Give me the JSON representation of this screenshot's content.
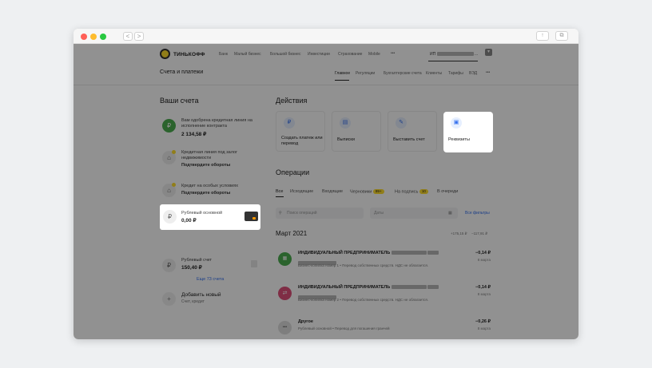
{
  "window": {
    "back": "<",
    "forward": ">",
    "share_icon": "↑",
    "tabs_icon": "⧉"
  },
  "header": {
    "brand": "ТИНЬКОФФ",
    "nav": [
      "Банк",
      "Малый бизнес",
      "Большой бизнес",
      "Инвестиции",
      "Страхование",
      "Mobile"
    ],
    "more": "•••",
    "account_prefix": "ИП",
    "account_suffix": "...",
    "account_chevron": "▾"
  },
  "subheader": {
    "title": "Счета и платежи",
    "tabs": [
      "Главное",
      "Регуляции",
      "Бухгалтерские счета",
      "Клиенты",
      "Тарифы",
      "ВЭД"
    ],
    "active_tab": 0,
    "more": "•••"
  },
  "accounts": {
    "title": "Ваши счета",
    "items": [
      {
        "title": "Вам одобрена кредитная линия на исполнение контракта",
        "value": "2 134,58 ₽",
        "icon": "₽"
      },
      {
        "title": "Кредитная линия под залог недвижимости",
        "sub": "Подтвердите обороты",
        "icon": "⌂"
      },
      {
        "title": "Кредит на особых условиях",
        "sub": "Подтвердите обороты",
        "icon": "⌂"
      },
      {
        "title": "Рублевый основной",
        "value": "0,00 ₽",
        "icon": "₽"
      },
      {
        "title": "Рублевый счет",
        "value": "150,40 ₽",
        "icon": "₽"
      }
    ],
    "more_link": "Еще 73 счета",
    "add_title": "Добавить новый",
    "add_sub": "Счет, кредит",
    "add_icon": "+"
  },
  "actions": {
    "title": "Действия",
    "items": [
      {
        "label": "Создать платеж или перевод",
        "icon": "₽"
      },
      {
        "label": "Выписки",
        "icon": "▤"
      },
      {
        "label": "Выставить счет",
        "icon": "✎"
      },
      {
        "label": "Реквизиты",
        "icon": "▣"
      }
    ]
  },
  "operations": {
    "title": "Операции",
    "tabs": [
      {
        "label": "Все"
      },
      {
        "label": "Исходящие"
      },
      {
        "label": "Входящие"
      },
      {
        "label": "Черновики",
        "badge": "99+"
      },
      {
        "label": "На подпись",
        "badge": "10"
      },
      {
        "label": "В очереди"
      }
    ],
    "search_placeholder": "Поиск операций",
    "date_placeholder": "Даты",
    "all_filters": "Все фильтры",
    "month": "Март 2021",
    "totals": [
      "+175,15 ₽",
      "−117,91 ₽"
    ],
    "items": [
      {
        "title": "ИНДИВИДУАЛЬНЫЙ ПРЕДПРИНИМАТЕЛЬ",
        "sub": "Бизнес-копилка номер 1  •  Перевод собственных средств. НДС не облагается.",
        "amount": "−0,14 ₽",
        "date": "8 марта",
        "color": "#4caf50",
        "icon": "▦"
      },
      {
        "title": "ИНДИВИДУАЛЬНЫЙ ПРЕДПРИНИМАТЕЛЬ",
        "sub": "Бизнес-копилка номер 2  •  Перевод собственных средств. НДС не облагается.",
        "amount": "−0,14 ₽",
        "date": "8 марта",
        "color": "#e0507a",
        "icon": "⇄"
      },
      {
        "title": "Другое",
        "sub": "Рублевый основной  •  Перевод для погашения гранчей",
        "amount": "−0,26 ₽",
        "date": "8 марта",
        "color": "#dddddd",
        "icon": "•••"
      }
    ]
  }
}
